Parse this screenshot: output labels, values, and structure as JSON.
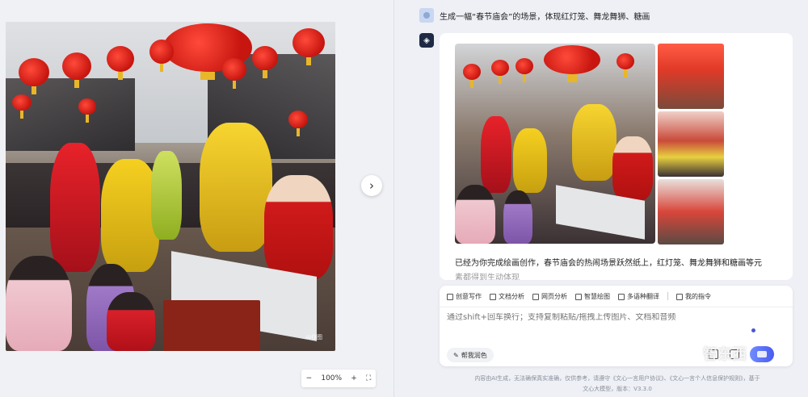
{
  "preview": {
    "ai_tag": "AI作图",
    "zoom_out": "−",
    "zoom_level": "100%",
    "zoom_in": "+",
    "fullscreen": "⛶",
    "next": "›"
  },
  "chat": {
    "user_message": "生成一幅“春节庙会”的场景，体现红灯笼、舞龙舞狮、糖画",
    "bot_reply": "已经为你完成绘画创作，春节庙会的热闹场景跃然纸上，红灯笼、舞龙舞狮和糖画等元",
    "bot_reply_cont": "素都得到生动体现"
  },
  "toolbar": {
    "items": [
      "创意写作",
      "文档分析",
      "网页分析",
      "智慧绘图",
      "多语种翻译",
      "我的指令"
    ]
  },
  "input": {
    "placeholder": "通过shift+回车换行；支持复制粘贴/拖拽上传图片、文档和音频",
    "polish_label": "帮我润色"
  },
  "footer": {
    "disclaimer_1": "内容由AI生成，无法确保真实准确，仅供参考，请遵守《文心一言用户协议》、《文心一言个人信息保护规则》，基于",
    "disclaimer_2": "文心大模型，版本：V3.3.0"
  },
  "watermark": "智东西",
  "colors": {
    "accent": "#4a5bf0",
    "lantern_red": "#d81e12"
  }
}
